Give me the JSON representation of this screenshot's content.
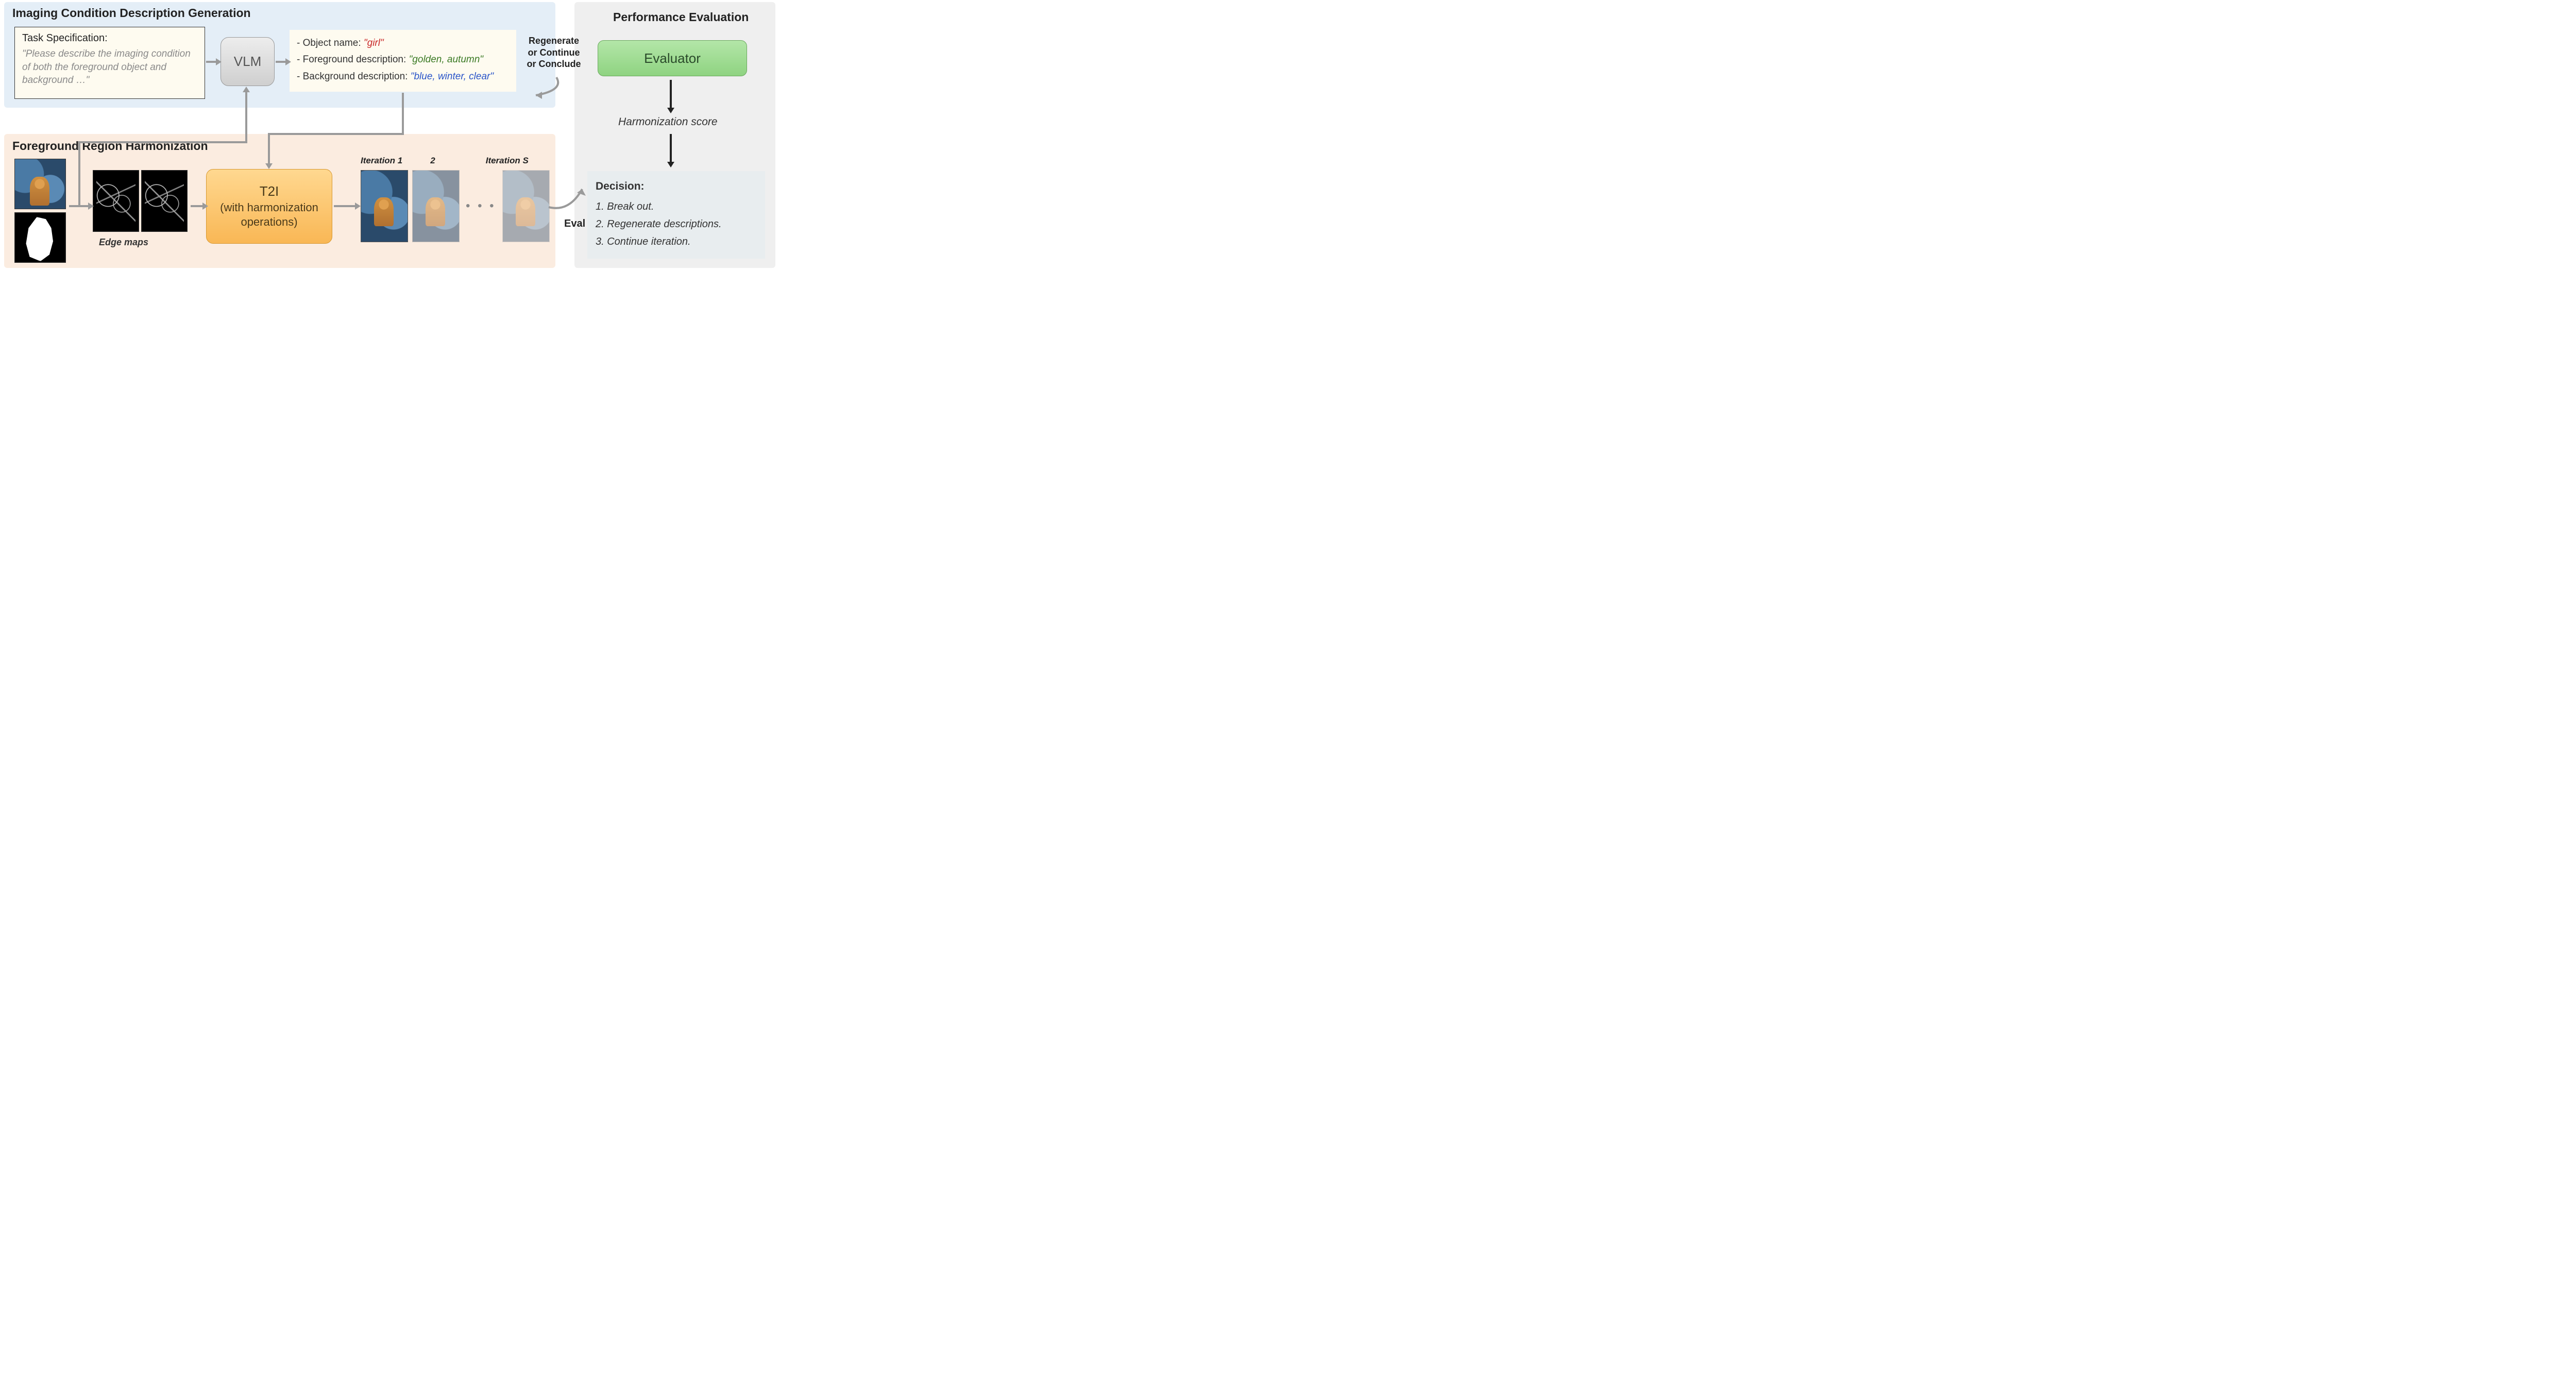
{
  "sections": {
    "imaging_title": "Imaging Condition Description Generation",
    "harmonization_title": "Foreground Region Harmonization",
    "performance_title": "Performance Evaluation"
  },
  "task_spec": {
    "label": "Task Specification:",
    "text": "\"Please describe the imaging condition of both the foreground object and background …\""
  },
  "vlm_label": "VLM",
  "descriptions": {
    "object_label": "- Object name: ",
    "object_value": "\"girl\"",
    "fg_label": "- Foreground description: ",
    "fg_value": "\"golden, autumn\"",
    "bg_label": "- Background description: ",
    "bg_value": "\"blue, winter, clear\""
  },
  "feedback_label": "Regenerate or Continue or Conclude",
  "edge_maps_label": "Edge maps",
  "t2i": {
    "top": "T2I",
    "sub": "(with harmonization operations)"
  },
  "iterations": {
    "label1": "Iteration 1",
    "label2": "2",
    "labelS": "Iteration S",
    "S_italic_note": "S"
  },
  "eval_label": "Eval",
  "evaluator_label": "Evaluator",
  "harmonization_score_label": "Harmonization score",
  "decision": {
    "title": "Decision:",
    "items": [
      "1. Break out.",
      "2. Regenerate descriptions.",
      "3. Continue iteration."
    ]
  }
}
